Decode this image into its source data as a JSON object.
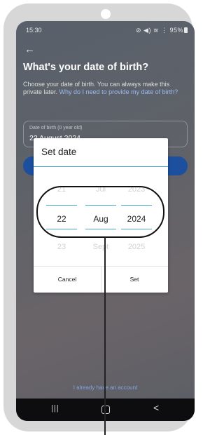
{
  "status_bar": {
    "time": "15:30",
    "icons_text": "⊘ ◀) ≋ ⋮ 95%",
    "battery": "95%"
  },
  "header": {
    "back": "←",
    "title": "What's your date of birth?"
  },
  "intro": {
    "text": "Choose your date of birth. You can always make this private later. ",
    "link": "Why do I need to provide my date of birth?"
  },
  "dob_field": {
    "label": "Date of birth (0 year old)",
    "value": "22 August 2024"
  },
  "dialog": {
    "title": "Set date",
    "day": {
      "above": "21",
      "selected": "22",
      "below": "23"
    },
    "month": {
      "above": "Jul",
      "selected": "Aug",
      "below": "Sept"
    },
    "year": {
      "above": "2023",
      "selected": "2024",
      "below": "2025"
    },
    "cancel": "Cancel",
    "set": "Set"
  },
  "footer": {
    "account_link": "I already have an account"
  },
  "nav": {
    "recent": "|||",
    "back": "<"
  }
}
